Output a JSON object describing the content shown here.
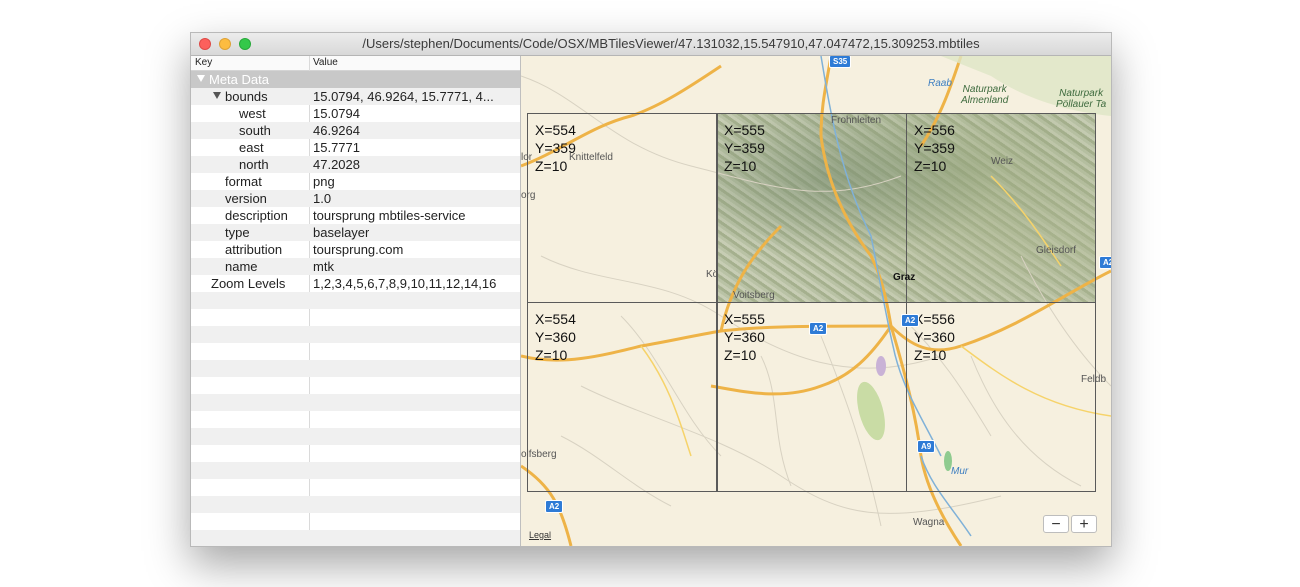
{
  "window": {
    "title": "/Users/stephen/Documents/Code/OSX/MBTilesViewer/47.131032,15.547910,47.047472,15.309253.mbtiles"
  },
  "table": {
    "columns": [
      "Key",
      "Value"
    ],
    "rows": [
      {
        "key": "Meta Data",
        "value": "",
        "indent": 0,
        "disclosure": "open",
        "selected": true
      },
      {
        "key": "bounds",
        "value": "15.0794, 46.9264, 15.7771, 4...",
        "indent": 1,
        "disclosure": "open"
      },
      {
        "key": "west",
        "value": "15.0794",
        "indent": 3
      },
      {
        "key": "south",
        "value": "46.9264",
        "indent": 3
      },
      {
        "key": "east",
        "value": "15.7771",
        "indent": 3
      },
      {
        "key": "north",
        "value": "47.2028",
        "indent": 3
      },
      {
        "key": "format",
        "value": "png",
        "indent": 2
      },
      {
        "key": "version",
        "value": "1.0",
        "indent": 2
      },
      {
        "key": "description",
        "value": "toursprung mbtiles-service",
        "indent": 2
      },
      {
        "key": "type",
        "value": "baselayer",
        "indent": 2
      },
      {
        "key": "attribution",
        "value": "toursprung.com",
        "indent": 2
      },
      {
        "key": "name",
        "value": "mtk",
        "indent": 2
      },
      {
        "key": "Zoom Levels",
        "value": "1,2,3,4,5,6,7,8,9,10,11,12,14,16",
        "indent": 1
      }
    ]
  },
  "map": {
    "tiles": [
      {
        "x": "X=554",
        "y": "Y=359",
        "z": "Z=10"
      },
      {
        "x": "X=555",
        "y": "Y=359",
        "z": "Z=10"
      },
      {
        "x": "X=556",
        "y": "Y=359",
        "z": "Z=10"
      },
      {
        "x": "X=554",
        "y": "Y=360",
        "z": "Z=10"
      },
      {
        "x": "X=555",
        "y": "Y=360",
        "z": "Z=10"
      },
      {
        "x": "X=556",
        "y": "Y=360",
        "z": "Z=10"
      }
    ],
    "places": {
      "knittelfeld": "Knittelfeld",
      "graz": "Graz",
      "voitsberg": "Voitsberg",
      "wagna": "Wagna",
      "feldbach": "Feldb",
      "wolfsberg": "olfsberg",
      "koflach": "Kö",
      "frohnleiten": "Frohnleiten",
      "weiz": "Weiz",
      "gleisdorf": "Gleisdorf",
      "mur": "Mur",
      "raab": "Raab",
      "org": "org",
      "lor": "lor"
    },
    "parks": {
      "almenland": "Naturpark\nAlmenland",
      "poellauer": "Naturpark\nPöllauer Ta"
    },
    "shields": [
      "S35",
      "A2",
      "A2",
      "A2",
      "A9",
      "A2"
    ],
    "legal": "Legal",
    "zoom_out": "−",
    "zoom_in": "+"
  }
}
